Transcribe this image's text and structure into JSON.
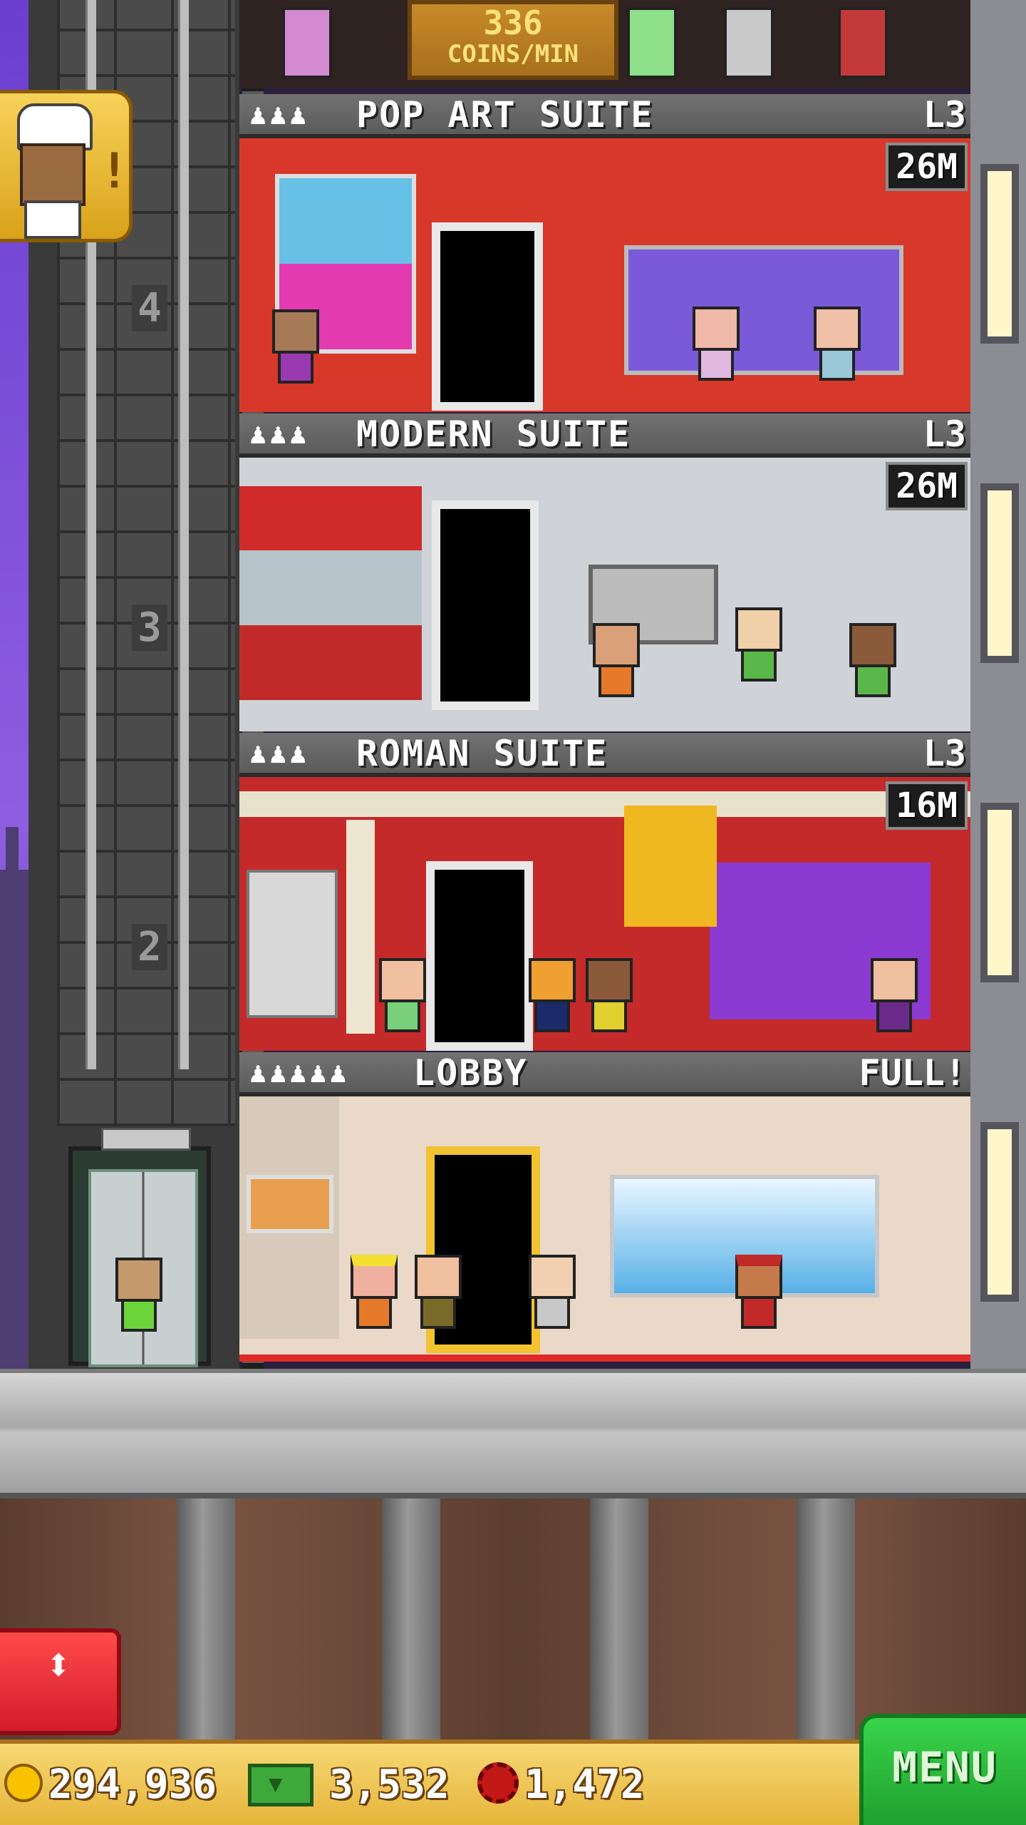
{
  "coins_banner": {
    "value": "336",
    "unit": "COINS/MIN"
  },
  "elevator": {
    "floor_numbers": [
      "4",
      "3",
      "2"
    ]
  },
  "floors": [
    {
      "id": "pop-art",
      "name": "POP ART SUITE",
      "level": "L3",
      "stock": "26M",
      "residents_icon": "♟♟♟"
    },
    {
      "id": "modern",
      "name": "MODERN SUITE",
      "level": "L3",
      "stock": "26M",
      "residents_icon": "♟♟♟"
    },
    {
      "id": "roman",
      "name": "ROMAN SUITE",
      "level": "L3",
      "stock": "16M",
      "residents_icon": "♟♟♟"
    },
    {
      "id": "lobby",
      "name": "LOBBY",
      "level": "FULL!",
      "residents_icon": "♟♟♟♟♟"
    }
  ],
  "notification": {
    "icon": "chef-icon",
    "alert": "!"
  },
  "elevator_control": {
    "icon": "up-down-arrows-icon",
    "label": "⬍"
  },
  "status_bar": {
    "coins": "294,936",
    "bux": "3,532",
    "points": "1,472",
    "menu_label": "MENU"
  },
  "colors": {
    "accent_gold": "#e6b43a",
    "menu_green": "#20a030",
    "elevator_red": "#d21c2c"
  }
}
